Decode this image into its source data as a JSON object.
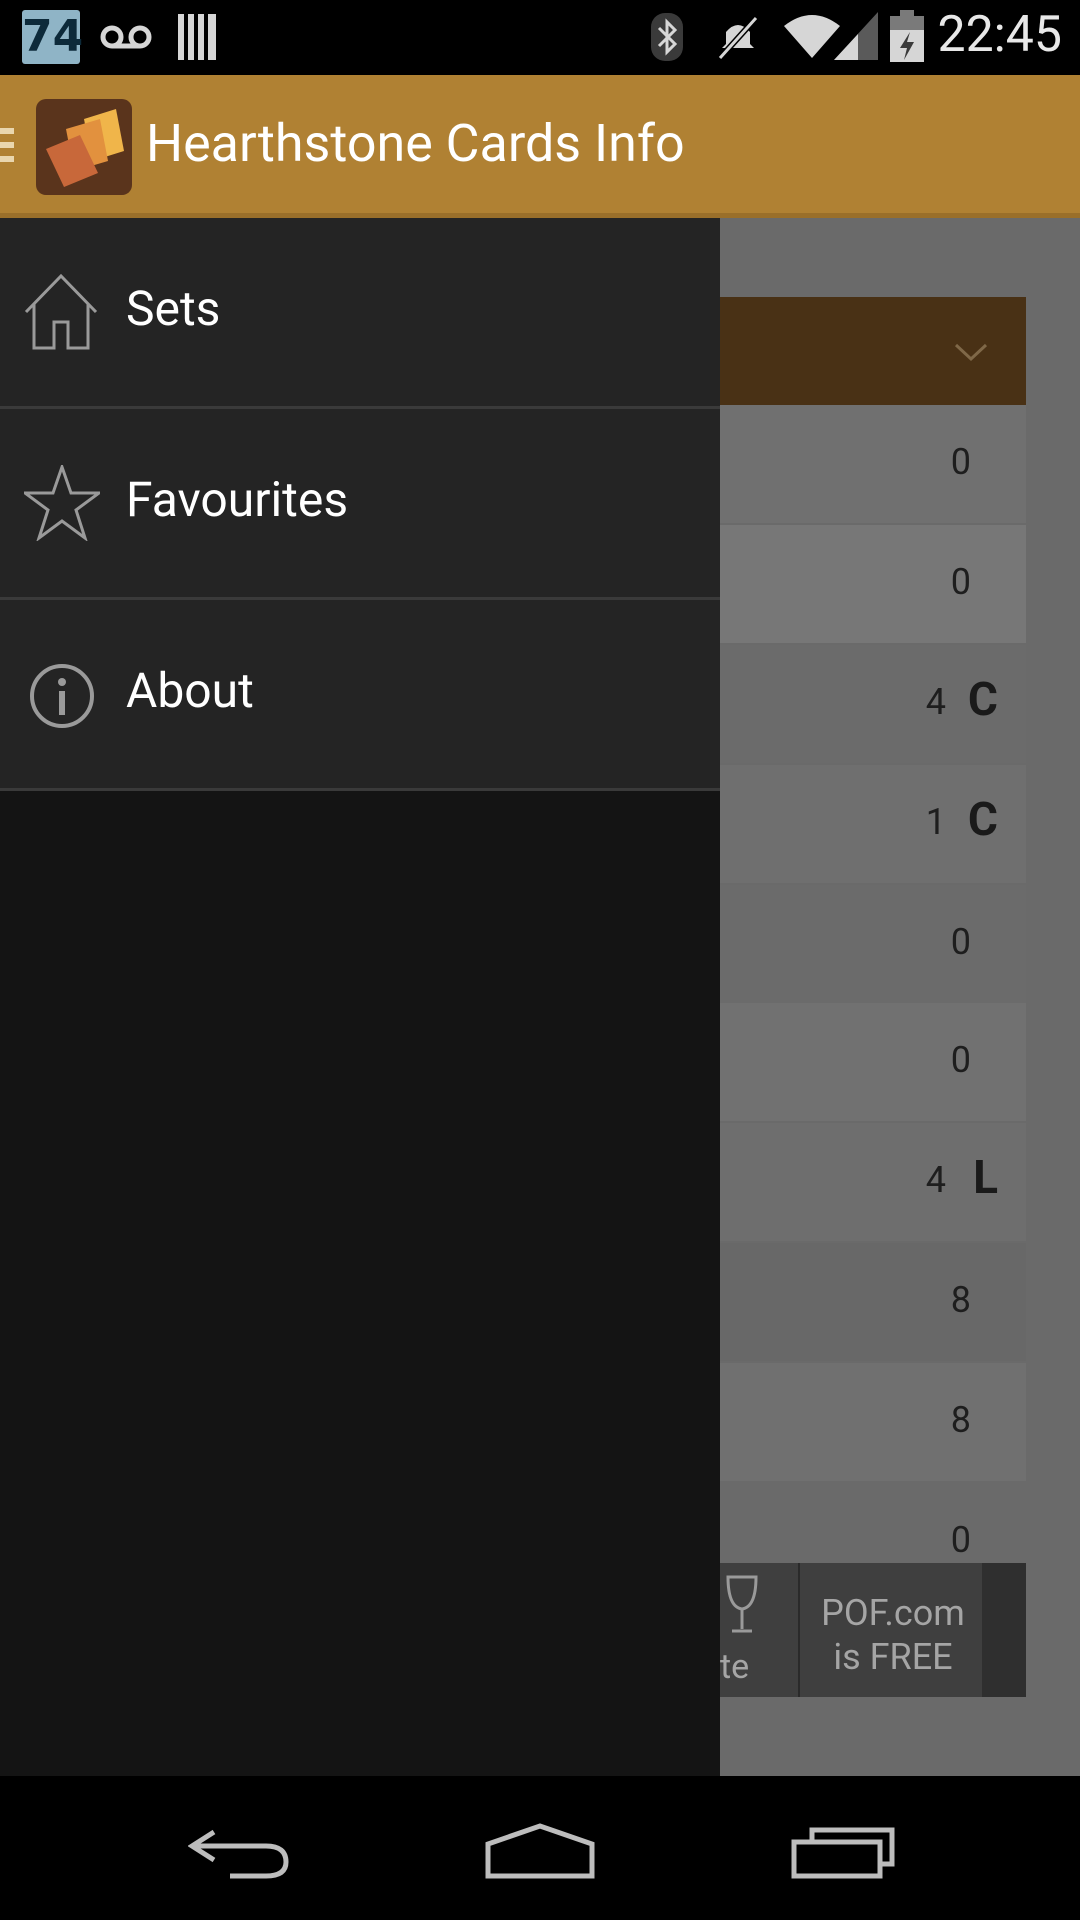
{
  "status_bar": {
    "notification_badge": "74",
    "time": "22:45",
    "icons": [
      "voicemail-icon",
      "barcode-icon",
      "bluetooth-icon",
      "mute-icon",
      "wifi-icon",
      "signal-icon",
      "battery-icon"
    ]
  },
  "action_bar": {
    "title": "Hearthstone Cards Info",
    "color": "#b08133"
  },
  "drawer": {
    "items": [
      {
        "label": "Sets",
        "icon": "home-icon"
      },
      {
        "label": "Favourites",
        "icon": "star-icon"
      },
      {
        "label": "About",
        "icon": "info-icon"
      }
    ]
  },
  "background_list": {
    "rows": [
      {
        "value": "0",
        "rarity": ""
      },
      {
        "value": "0",
        "rarity": ""
      },
      {
        "value": "4",
        "rarity": "C"
      },
      {
        "value": "1",
        "rarity": "C"
      },
      {
        "value": "0",
        "rarity": ""
      },
      {
        "value": "0",
        "rarity": ""
      },
      {
        "value": "4",
        "rarity": "L"
      },
      {
        "value": "8",
        "rarity": ""
      },
      {
        "value": "8",
        "rarity": ""
      },
      {
        "value": "0",
        "rarity": ""
      }
    ]
  },
  "ad": {
    "line1": "POF.com",
    "line2": "is FREE",
    "fragment": "te"
  }
}
